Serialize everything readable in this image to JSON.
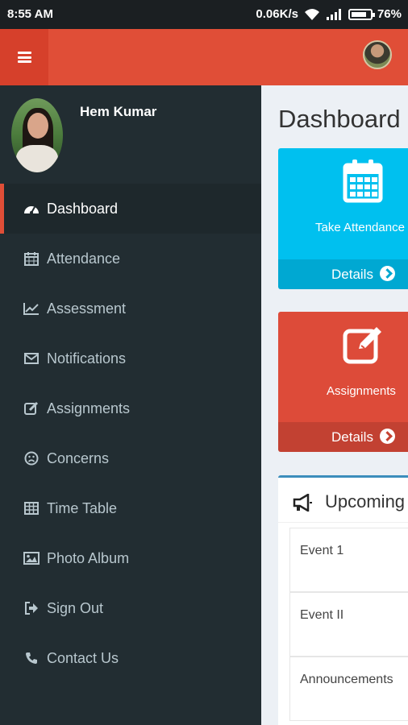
{
  "status_bar": {
    "time": "8:55 AM",
    "network_speed": "0.06K/s",
    "battery": "76%",
    "icons": [
      "wifi-icon",
      "signal-icon",
      "battery-icon"
    ]
  },
  "header": {
    "menu_icon": "hamburger-icon",
    "avatar": "user-avatar",
    "colors": {
      "bar": "#e04e37",
      "menu_button": "#d6402b"
    }
  },
  "sidebar": {
    "user_name": "Hem Kumar",
    "items": [
      {
        "label": "Dashboard",
        "icon": "dashboard-icon",
        "active": true
      },
      {
        "label": "Attendance",
        "icon": "calendar-icon"
      },
      {
        "label": "Assessment",
        "icon": "line-chart-icon"
      },
      {
        "label": "Notifications",
        "icon": "envelope-icon"
      },
      {
        "label": "Assignments",
        "icon": "edit-icon"
      },
      {
        "label": "Concerns",
        "icon": "frown-icon"
      },
      {
        "label": "Time Table",
        "icon": "table-icon"
      },
      {
        "label": "Photo Album",
        "icon": "picture-icon"
      },
      {
        "label": "Sign Out",
        "icon": "sign-out-icon"
      },
      {
        "label": "Contact Us",
        "icon": "phone-icon"
      }
    ],
    "colors": {
      "background": "#222d32",
      "active_background": "#1e282c",
      "active_indicator": "#e04e37",
      "text": "#b8c7ce"
    }
  },
  "main": {
    "title": "Dashboard",
    "cards": [
      {
        "label": "Take Attendance",
        "footer": "Details",
        "icon": "calendar-icon",
        "color": "#00c0ef"
      },
      {
        "label": "Assignments",
        "footer": "Details",
        "icon": "edit-icon",
        "color": "#dd4b39"
      }
    ],
    "upcoming": {
      "title": "Upcoming",
      "icon": "megaphone-icon",
      "rows": [
        "Event 1",
        "Event II",
        "Announcements"
      ]
    }
  }
}
